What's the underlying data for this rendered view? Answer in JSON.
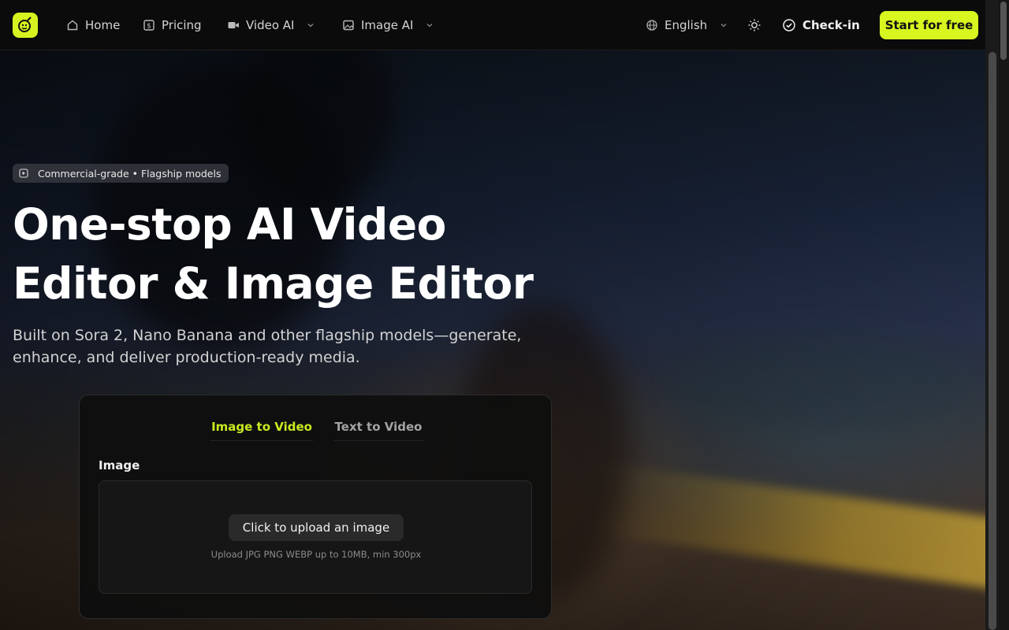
{
  "nav": {
    "items": [
      {
        "label": "Home",
        "icon": "home-icon"
      },
      {
        "label": "Pricing",
        "icon": "pricing-icon"
      },
      {
        "label": "Video AI",
        "icon": "video-camera-icon"
      },
      {
        "label": "Image AI",
        "icon": "image-icon"
      }
    ],
    "language": "English",
    "checkin": "Check-in",
    "start": "Start for free"
  },
  "hero": {
    "badge": "Commercial-grade • Flagship models",
    "headline_line1": "One-stop AI Video",
    "headline_line2": "Editor & Image Editor",
    "subline": "Built on Sora 2, Nano Banana and other flagship models—generate, enhance, and deliver production-ready media."
  },
  "panel": {
    "tabs": [
      "Image to Video",
      "Text to Video"
    ],
    "active_tab": "Image to Video",
    "field_label": "Image",
    "upload_button": "Click to upload an image",
    "upload_hint": "Upload JPG PNG WEBP up to 10MB, min 300px"
  },
  "colors": {
    "accent": "#d8f61f",
    "background": "#0a0a0a"
  }
}
